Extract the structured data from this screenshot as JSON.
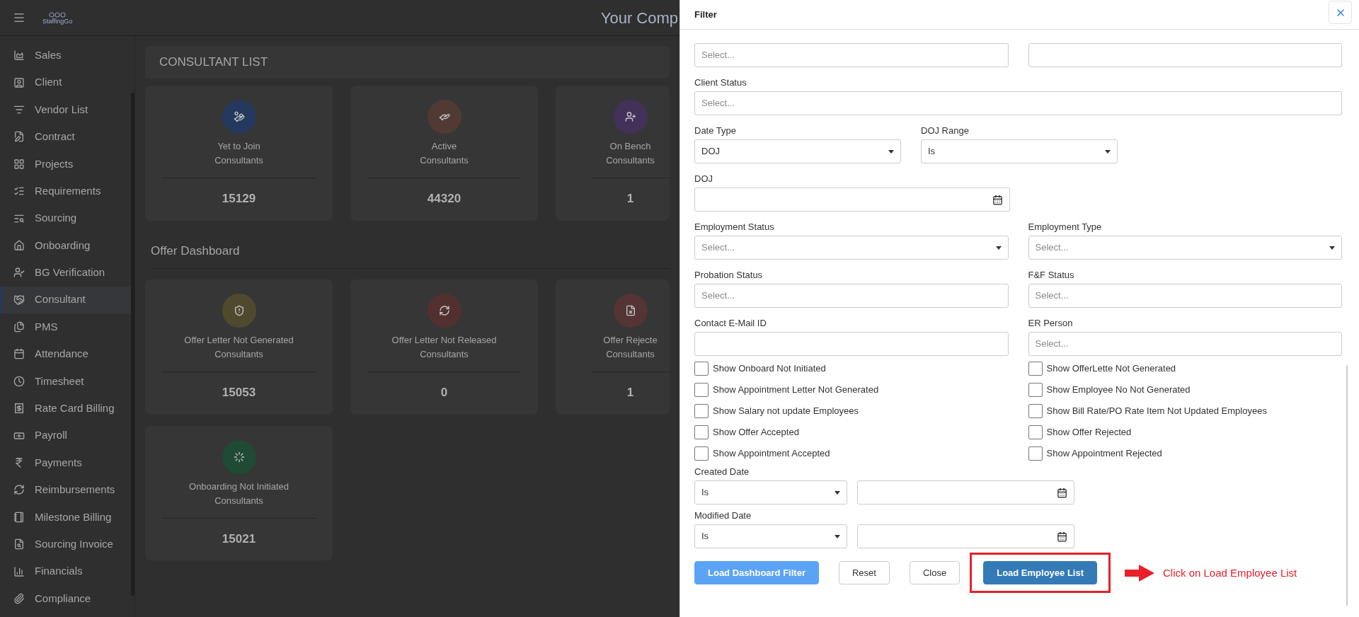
{
  "app": {
    "logo_text": "StaffingGo",
    "header_title": "Your Comp"
  },
  "sidebar": {
    "items": [
      {
        "label": "Sales",
        "selected": false
      },
      {
        "label": "Client",
        "selected": false
      },
      {
        "label": "Vendor List",
        "selected": false
      },
      {
        "label": "Contract",
        "selected": false
      },
      {
        "label": "Projects",
        "selected": false
      },
      {
        "label": "Requirements",
        "selected": false
      },
      {
        "label": "Sourcing",
        "selected": false
      },
      {
        "label": "Onboarding",
        "selected": false
      },
      {
        "label": "BG Verification",
        "selected": false
      },
      {
        "label": "Consultant",
        "selected": true
      },
      {
        "label": "PMS",
        "selected": false
      },
      {
        "label": "Attendance",
        "selected": false
      },
      {
        "label": "Timesheet",
        "selected": false
      },
      {
        "label": "Rate Card Billing",
        "selected": false
      },
      {
        "label": "Payroll",
        "selected": false
      },
      {
        "label": "Payments",
        "selected": false
      },
      {
        "label": "Reimbursements",
        "selected": false
      },
      {
        "label": "Milestone Billing",
        "selected": false
      },
      {
        "label": "Sourcing Invoice",
        "selected": false
      },
      {
        "label": "Financials",
        "selected": false
      },
      {
        "label": "Compliance",
        "selected": false
      }
    ]
  },
  "consultant_list": {
    "title": "CONSULTANT LIST",
    "cards": [
      {
        "label_lines": [
          "Yet to Join",
          "Consultants"
        ],
        "count": "15129",
        "color": "#25395e"
      },
      {
        "label_lines": [
          "Active",
          "Consultants"
        ],
        "count": "44320",
        "color": "#503a33"
      },
      {
        "label_lines": [
          "On Bench",
          "Consultants"
        ],
        "count": "1",
        "color": "#42325a"
      }
    ]
  },
  "offer_dashboard": {
    "title": "Offer Dashboard",
    "cards": [
      {
        "label_lines": [
          "Offer Letter Not Generated",
          "Consultants"
        ],
        "count": "15053",
        "color": "#4f4a2e"
      },
      {
        "label_lines": [
          "Offer Letter Not Released",
          "Consultants"
        ],
        "count": "0",
        "color": "#533030"
      },
      {
        "label_lines": [
          "Offer Rejecte",
          "Consultants"
        ],
        "count": "1",
        "color": "#543434"
      },
      {
        "label_lines": [
          "Onboarding Not Initiated",
          "Consultants"
        ],
        "count": "15021",
        "color": "#1f4a34"
      }
    ]
  },
  "filter": {
    "title": "Filter",
    "top_row": {
      "placeholder": "Select..."
    },
    "client_status": {
      "label": "Client Status",
      "placeholder": "Select..."
    },
    "date_type": {
      "label": "Date Type",
      "value": "DOJ"
    },
    "doj_range": {
      "label": "DOJ Range",
      "value": "Is"
    },
    "doj": {
      "label": "DOJ"
    },
    "pairs": [
      [
        {
          "label": "Employment Status",
          "kind": "dropdown",
          "placeholder": "Select..."
        },
        {
          "label": "Employment Type",
          "kind": "dropdown",
          "placeholder": "Select..."
        }
      ],
      [
        {
          "label": "Probation Status",
          "kind": "select",
          "placeholder": "Select..."
        },
        {
          "label": "F&F Status",
          "kind": "select",
          "placeholder": "Select..."
        }
      ],
      [
        {
          "label": "Contact E-Mail ID",
          "kind": "text"
        },
        {
          "label": "ER Person",
          "kind": "select",
          "placeholder": "Select..."
        }
      ]
    ],
    "checkboxes": [
      {
        "label": "Show Onboard Not Initiated",
        "checked": false
      },
      {
        "label": "Show OfferLette Not Generated",
        "checked": false
      },
      {
        "label": "Show Appointment Letter Not Generated",
        "checked": false
      },
      {
        "label": "Show Employee No Not Generated",
        "checked": false
      },
      {
        "label": "Show Salary not update Employees",
        "checked": false
      },
      {
        "label": "Show Bill Rate/PO Rate Item Not Updated Employees",
        "checked": false
      },
      {
        "label": "Show Offer Accepted",
        "checked": false
      },
      {
        "label": "Show Offer Rejected",
        "checked": false
      },
      {
        "label": "Show Appointment Accepted",
        "checked": false
      },
      {
        "label": "Show Appointment Rejected",
        "checked": false
      }
    ],
    "date_filters": [
      {
        "label": "Created Date",
        "operator": "Is"
      },
      {
        "label": "Modified Date",
        "operator": "Is"
      }
    ],
    "buttons": [
      {
        "label": "Load Dashboard Filter",
        "kind": "primary-light",
        "highlighted": false
      },
      {
        "label": "Reset",
        "kind": "outline",
        "highlighted": false
      },
      {
        "label": "Close",
        "kind": "outline",
        "highlighted": false
      },
      {
        "label": "Load Employee List",
        "kind": "primary",
        "highlighted": true
      }
    ],
    "annotation": {
      "text": "Click on Load Employee List"
    }
  }
}
